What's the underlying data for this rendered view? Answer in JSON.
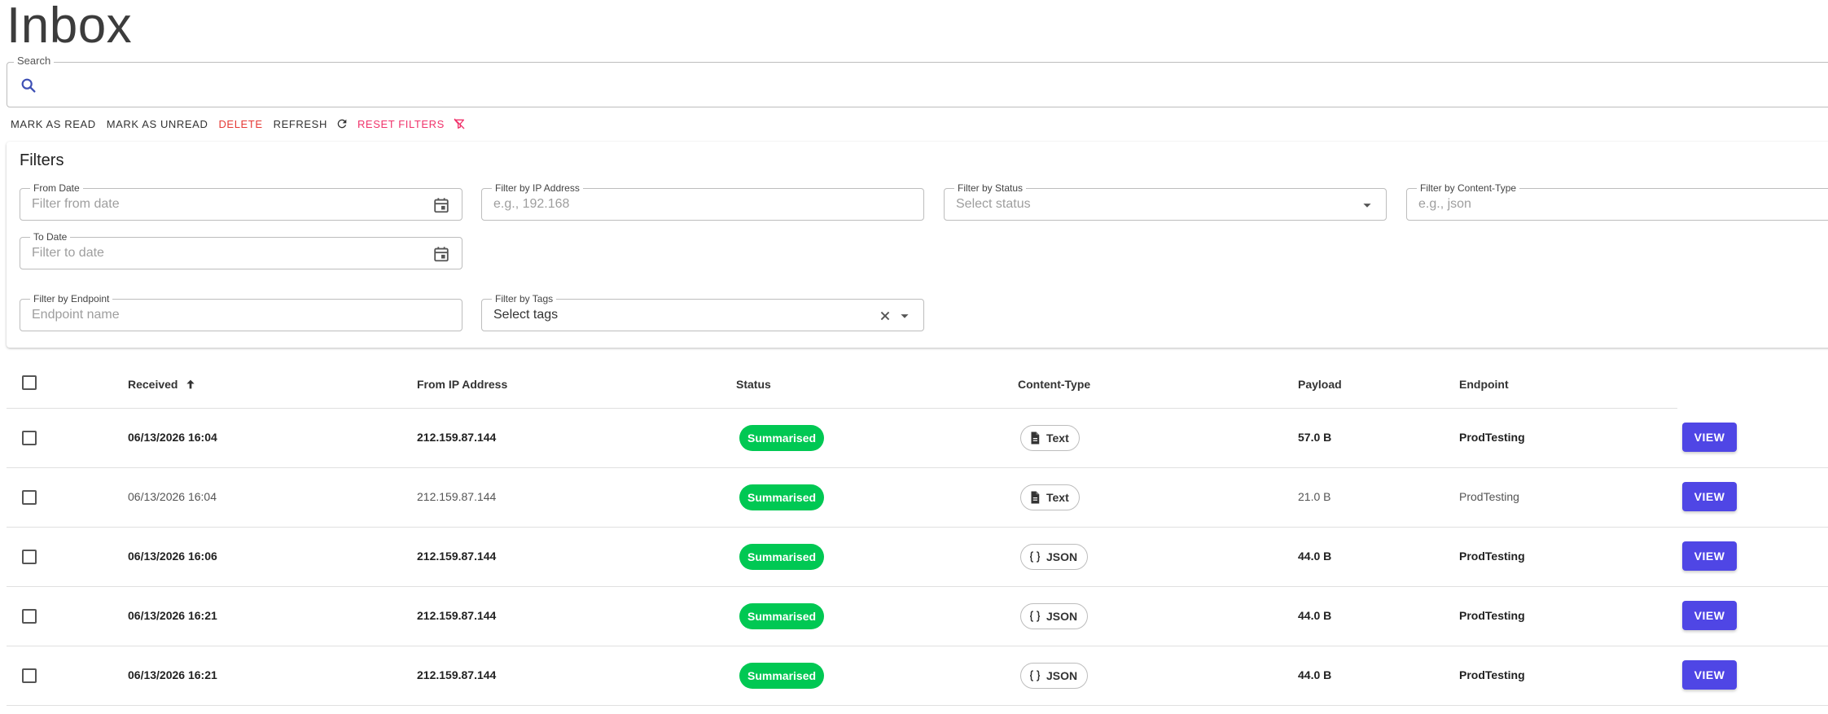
{
  "page": {
    "title": "Inbox"
  },
  "search": {
    "label": "Search",
    "value": ""
  },
  "actions": {
    "mark_read": "MARK AS READ",
    "mark_unread": "MARK AS UNREAD",
    "delete": "DELETE",
    "refresh": "REFRESH",
    "reset_filters": "RESET FILTERS"
  },
  "filters": {
    "title": "Filters",
    "from_date": {
      "label": "From Date",
      "placeholder": "Filter from date"
    },
    "to_date": {
      "label": "To Date",
      "placeholder": "Filter to date"
    },
    "ip": {
      "label": "Filter by IP Address",
      "placeholder": "e.g., 192.168"
    },
    "status": {
      "label": "Filter by Status",
      "placeholder": "Select status"
    },
    "content_type": {
      "label": "Filter by Content-Type",
      "placeholder": "e.g., json"
    },
    "endpoint": {
      "label": "Filter by Endpoint",
      "placeholder": "Endpoint name"
    },
    "tags": {
      "label": "Filter by Tags",
      "value": "Select tags"
    }
  },
  "table": {
    "columns": {
      "received": "Received",
      "from_ip": "From IP Address",
      "status": "Status",
      "content_type": "Content-Type",
      "payload": "Payload",
      "endpoint": "Endpoint"
    },
    "view_label": "VIEW",
    "rows": [
      {
        "received": "06/13/2026 16:04",
        "ip": "212.159.87.144",
        "status": "Summarised",
        "content_type": "Text",
        "content_icon": "document-icon",
        "payload": "57.0 B",
        "endpoint": "ProdTesting",
        "unread": true
      },
      {
        "received": "06/13/2026 16:04",
        "ip": "212.159.87.144",
        "status": "Summarised",
        "content_type": "Text",
        "content_icon": "document-icon",
        "payload": "21.0 B",
        "endpoint": "ProdTesting",
        "unread": false
      },
      {
        "received": "06/13/2026 16:06",
        "ip": "212.159.87.144",
        "status": "Summarised",
        "content_type": "JSON",
        "content_icon": "braces-icon",
        "payload": "44.0 B",
        "endpoint": "ProdTesting",
        "unread": true
      },
      {
        "received": "06/13/2026 16:21",
        "ip": "212.159.87.144",
        "status": "Summarised",
        "content_type": "JSON",
        "content_icon": "braces-icon",
        "payload": "44.0 B",
        "endpoint": "ProdTesting",
        "unread": true
      },
      {
        "received": "06/13/2026 16:21",
        "ip": "212.159.87.144",
        "status": "Summarised",
        "content_type": "JSON",
        "content_icon": "braces-icon",
        "payload": "44.0 B",
        "endpoint": "ProdTesting",
        "unread": true
      }
    ]
  },
  "colors": {
    "accent": "#4f46e5",
    "status_green": "#00c853",
    "delete_red": "#e53935",
    "reset_pink": "#f0336b",
    "search_icon_blue": "#3f51b5"
  }
}
